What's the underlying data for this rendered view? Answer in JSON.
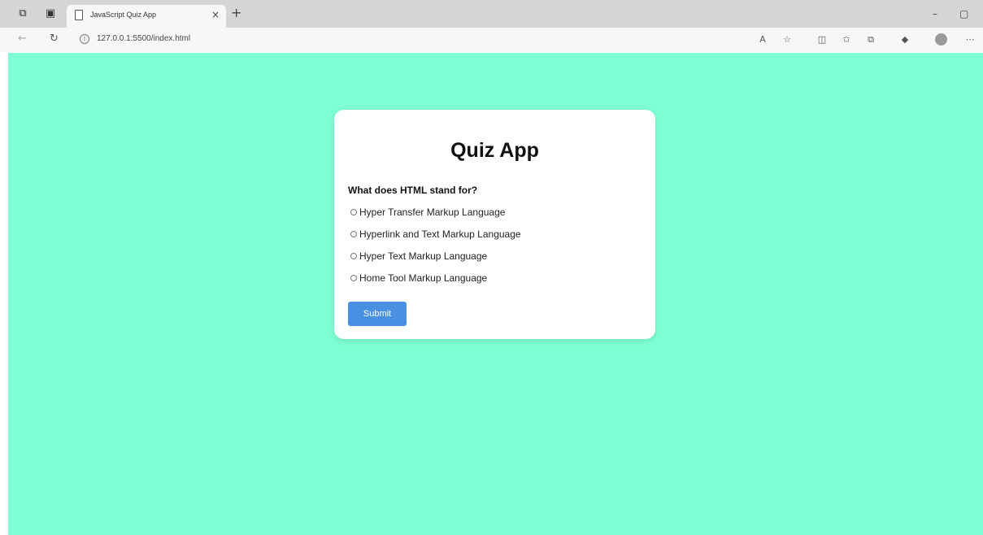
{
  "browser": {
    "tab_title": "JavaScript Quiz App",
    "tab_close": "×",
    "new_tab": "+",
    "url": "127.0.0.1:5500/index.html",
    "window_controls": {
      "minimize": "–",
      "maximize": "▢"
    },
    "nav": {
      "back": "←",
      "refresh": "↻"
    },
    "toolbar_icons": [
      "read-aloud-icon",
      "favorite-star-icon",
      "split-screen-icon",
      "favorites-icon",
      "collections-icon",
      "extensions-icon",
      "profile-icon",
      "more-icon"
    ]
  },
  "page": {
    "background": "#7fffd4",
    "card": {
      "title": "Quiz App",
      "question": "What does HTML stand for?",
      "options": [
        "Hyper Transfer Markup Language",
        "Hyperlink and Text Markup Language",
        "Hyper Text Markup Language",
        "Home Tool Markup Language"
      ],
      "submit_label": "Submit",
      "submit_color": "#4a90e2"
    }
  }
}
